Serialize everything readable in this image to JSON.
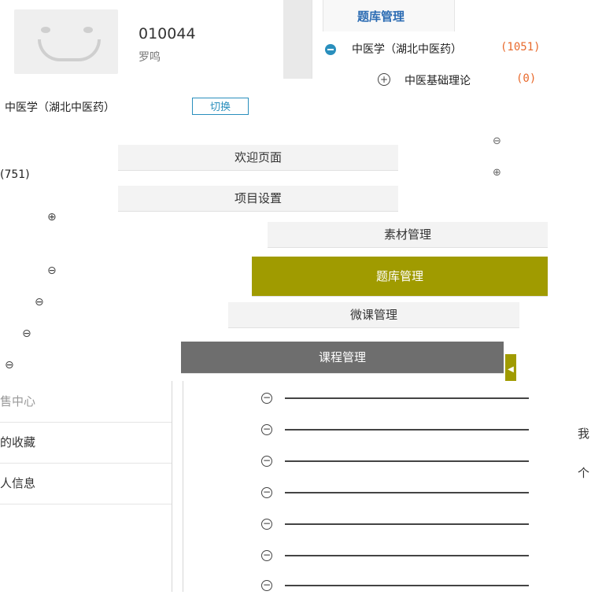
{
  "user": {
    "id": "010044",
    "name": "罗鸣"
  },
  "tree_panel": {
    "tab_label": "题库管理",
    "root": {
      "label": "中医学（湖北中医药）",
      "count": "(1051)"
    },
    "child": {
      "label": "中医基础理论",
      "count": "(0)"
    }
  },
  "context": {
    "label": "中医学（湖北中医药）",
    "switch_label": "切换"
  },
  "menu": {
    "items": [
      {
        "label": "欢迎页面"
      },
      {
        "label": "项目设置"
      },
      {
        "label": "素材管理"
      },
      {
        "label": "题库管理"
      },
      {
        "label": "微课管理"
      },
      {
        "label": "课程管理"
      }
    ],
    "active_index": 3
  },
  "left_tree": {
    "count_fragment": "(751)"
  },
  "sidebar": {
    "items": [
      {
        "label": "售中心"
      },
      {
        "label": "的收藏"
      },
      {
        "label": "人信息"
      }
    ]
  },
  "right_cut": {
    "a": "我",
    "b": "个"
  },
  "colors": {
    "accent_olive": "#a09b00",
    "accent_blue": "#2a8fbd",
    "count_orange": "#e8692b",
    "menu_dark": "#6e6e6e"
  }
}
